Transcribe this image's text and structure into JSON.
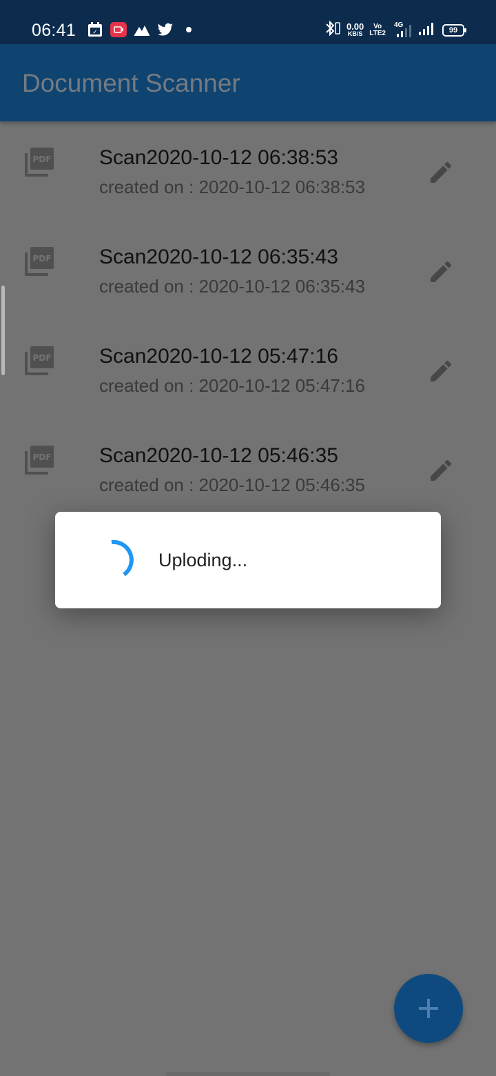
{
  "status_bar": {
    "time": "06:41",
    "net_speed": "0.00",
    "net_unit": "KB/S",
    "volte": "Vo",
    "volte_sub": "LTE2",
    "network": "4G",
    "battery": "99",
    "icons": [
      "calendar-icon",
      "screen-record-icon",
      "notification-icon",
      "twitter-icon",
      "dot-icon",
      "bluetooth-icon",
      "signal-icon"
    ]
  },
  "appbar": {
    "title": "Document Scanner"
  },
  "documents": [
    {
      "title": "Scan2020-10-12 06:38:53",
      "subtitle": "created on : 2020-10-12 06:38:53"
    },
    {
      "title": "Scan2020-10-12 06:35:43",
      "subtitle": "created on : 2020-10-12 06:35:43"
    },
    {
      "title": "Scan2020-10-12 05:47:16",
      "subtitle": "created on : 2020-10-12 05:47:16"
    },
    {
      "title": "Scan2020-10-12 05:46:35",
      "subtitle": "created on : 2020-10-12 05:46:35"
    }
  ],
  "dialog": {
    "message": "Uploding..."
  },
  "colors": {
    "appbar": "#0f4471",
    "status_bar": "#0d2c4d",
    "fab": "#0e4a80",
    "spinner": "#2196f3",
    "overlay": "#737373"
  }
}
